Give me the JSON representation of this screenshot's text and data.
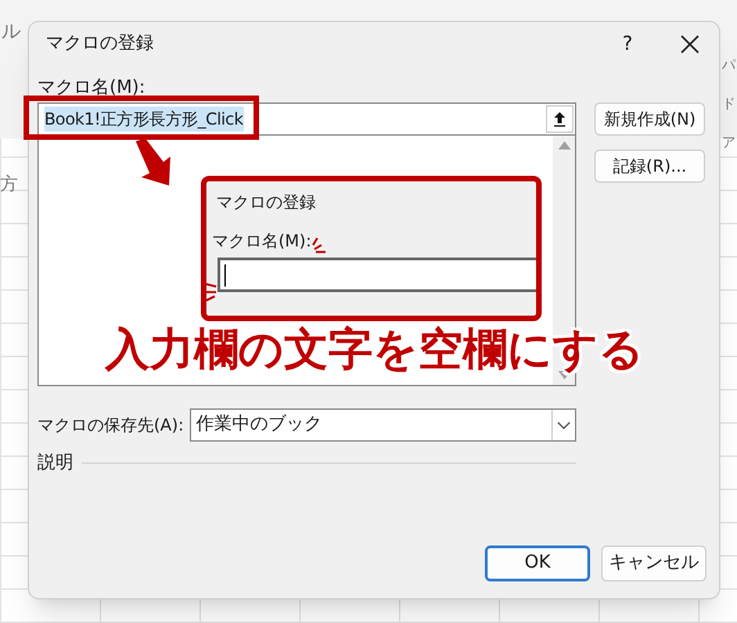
{
  "background": {
    "ribbon_tab": "ル",
    "sheet_text": "方",
    "right_ribbon": [
      "パ",
      "ド",
      "ア"
    ]
  },
  "dialog": {
    "title": "マクロの登録",
    "help": "?",
    "macro_name": {
      "label": "マクロ名(M):",
      "value": "Book1!正方形長方形_Click",
      "selected": true
    },
    "side_buttons": [
      {
        "label": "新規作成(N)"
      },
      {
        "label": "記録(R)..."
      }
    ],
    "save_location": {
      "label": "マクロの保存先(A):",
      "value": "作業中のブック"
    },
    "description": {
      "label": "説明"
    },
    "buttons": [
      {
        "label": "OK",
        "default": true
      },
      {
        "label": "キャンセル",
        "default": false
      }
    ]
  },
  "annotation": {
    "inset": {
      "title": "マクロの登録",
      "label": "マクロ名(M):"
    },
    "caption": "入力欄の文字を空欄にする"
  }
}
